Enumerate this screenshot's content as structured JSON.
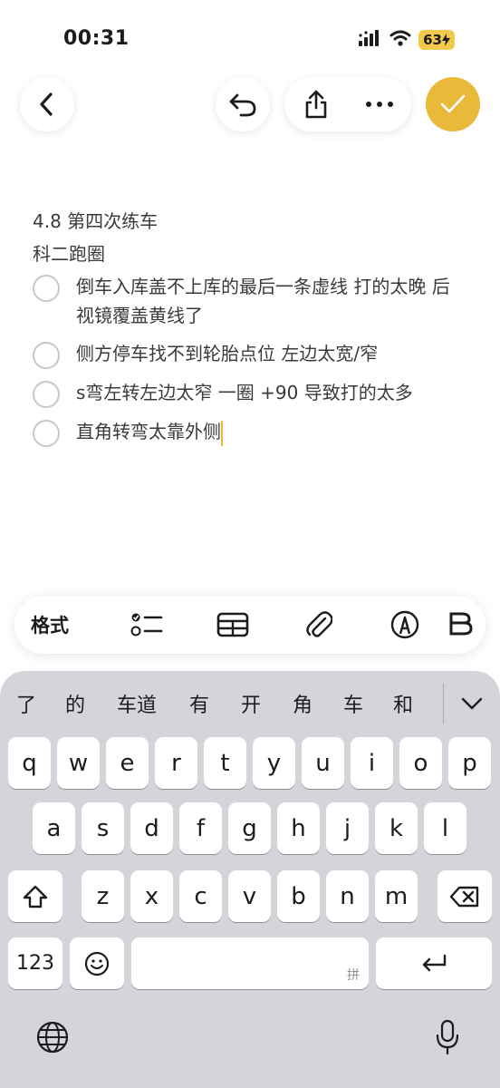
{
  "status": {
    "time": "00:31",
    "battery": "63"
  },
  "toolbar": {
    "back_icon": "chevron-left-icon",
    "undo_icon": "undo-icon",
    "share_icon": "share-icon",
    "more_icon": "ellipsis-icon",
    "done_icon": "checkmark-icon",
    "accent": "#e9b93a"
  },
  "note": {
    "line1": "4.8 第四次练车",
    "line2": "科二跑圈",
    "items": [
      {
        "text": "倒车入库盖不上库的最后一条虚线 打的太晚 后视镜覆盖黄线了"
      },
      {
        "text": "侧方停车找不到轮胎点位 左边太宽/窄"
      },
      {
        "text": "s弯左转左边太窄 一圈 +90 导致打的太多"
      },
      {
        "text": "直角转弯太靠外侧"
      }
    ]
  },
  "format_bar": {
    "format_label": "格式",
    "icons": [
      "checklist-icon",
      "table-icon",
      "attachment-icon",
      "markup-pen-icon"
    ]
  },
  "keyboard": {
    "candidates": [
      "了",
      "的",
      "车道",
      "有",
      "开",
      "角",
      "车",
      "和"
    ],
    "row1": [
      "q",
      "w",
      "e",
      "r",
      "t",
      "y",
      "u",
      "i",
      "o",
      "p"
    ],
    "row2": [
      "a",
      "s",
      "d",
      "f",
      "g",
      "h",
      "j",
      "k",
      "l"
    ],
    "row3": [
      "z",
      "x",
      "c",
      "v",
      "b",
      "n",
      "m"
    ],
    "numbers_label": "123",
    "space_hint": "拼"
  }
}
